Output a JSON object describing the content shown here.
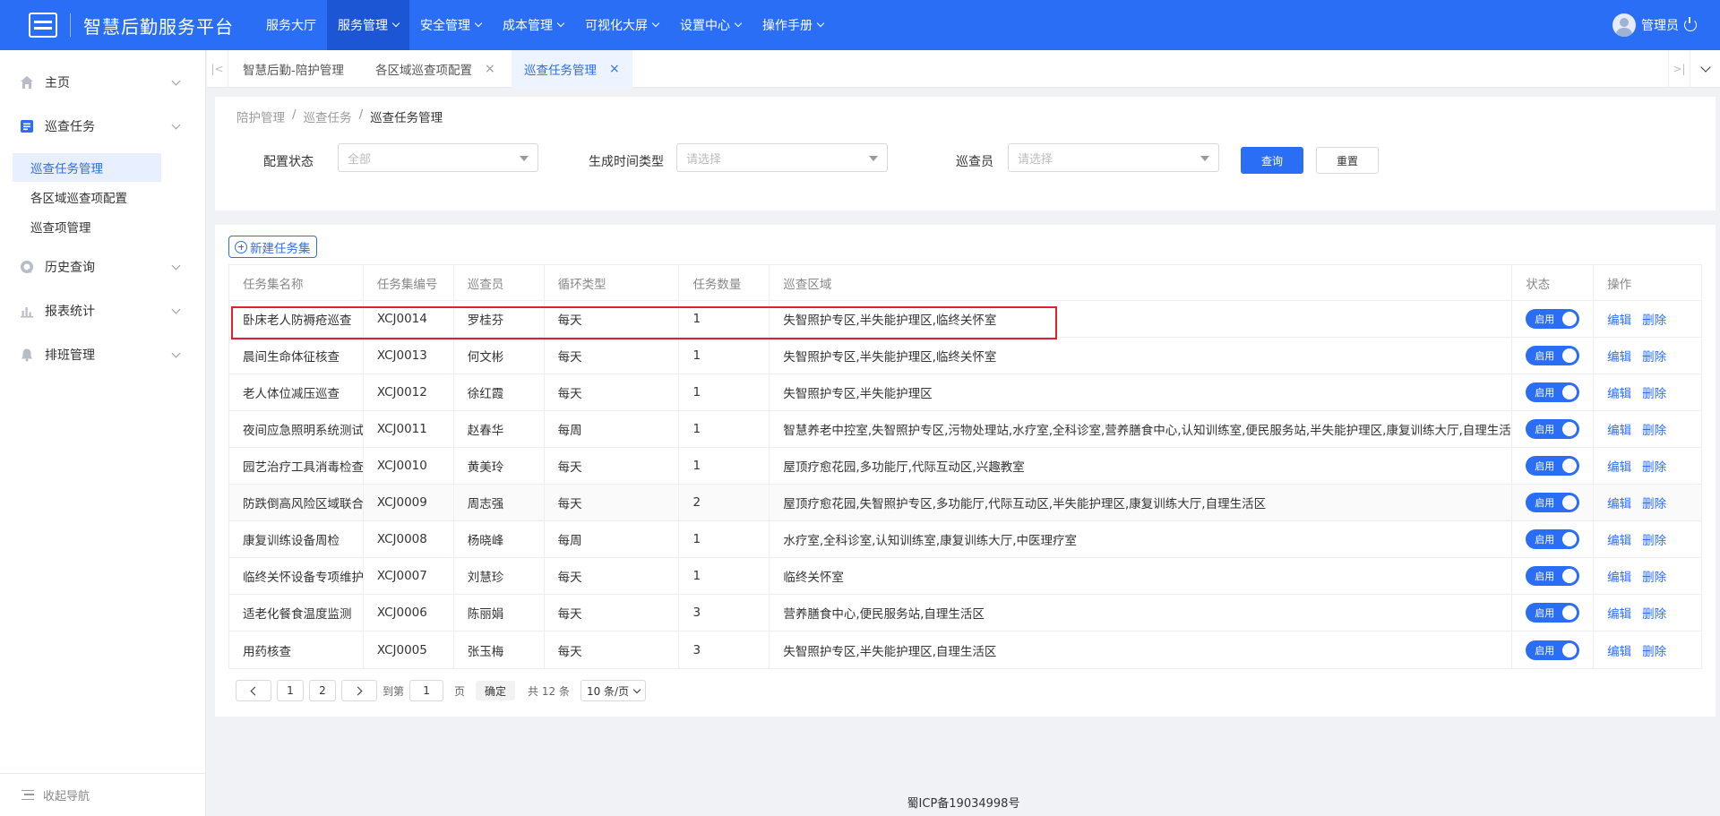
{
  "header": {
    "app_title": "智慧后勤服务平台",
    "nav": [
      {
        "label": "服务大厅",
        "dropdown": false,
        "active": false
      },
      {
        "label": "服务管理",
        "dropdown": true,
        "active": true
      },
      {
        "label": "安全管理",
        "dropdown": true,
        "active": false
      },
      {
        "label": "成本管理",
        "dropdown": true,
        "active": false
      },
      {
        "label": "可视化大屏",
        "dropdown": true,
        "active": false
      },
      {
        "label": "设置中心",
        "dropdown": true,
        "active": false
      },
      {
        "label": "操作手册",
        "dropdown": true,
        "active": false
      }
    ],
    "user_name": "管理员"
  },
  "sidebar": {
    "items": [
      {
        "label": "主页",
        "icon": "home-icon"
      },
      {
        "label": "巡查任务",
        "icon": "task-icon"
      },
      {
        "label": "历史查询",
        "icon": "history-icon"
      },
      {
        "label": "报表统计",
        "icon": "chart-icon"
      },
      {
        "label": "排班管理",
        "icon": "bell-icon"
      }
    ],
    "sub_items": [
      {
        "label": "巡查任务管理",
        "active": true
      },
      {
        "label": "各区域巡查项配置",
        "active": false
      },
      {
        "label": "巡查项管理",
        "active": false
      }
    ],
    "collapse_label": "收起导航"
  },
  "tabs": [
    {
      "label": "智慧后勤-陪护管理",
      "closable": false,
      "active": false
    },
    {
      "label": "各区域巡查项配置",
      "closable": true,
      "active": false
    },
    {
      "label": "巡查任务管理",
      "closable": true,
      "active": true
    }
  ],
  "breadcrumb": [
    "陪护管理",
    "巡查任务",
    "巡查任务管理"
  ],
  "filters": {
    "status_label": "配置状态",
    "status_value": "全部",
    "time_type_label": "生成时间类型",
    "time_type_placeholder": "请选择",
    "inspector_label": "巡查员",
    "inspector_placeholder": "请选择",
    "query_label": "查询",
    "reset_label": "重置"
  },
  "new_button_label": "新建任务集",
  "table": {
    "columns": [
      "任务集名称",
      "任务集编号",
      "巡查员",
      "循环类型",
      "任务数量",
      "巡查区域",
      "状态",
      "操作"
    ],
    "rows": [
      {
        "name": "卧床老人防褥疮巡查",
        "code": "XCJ0014",
        "inspector": "罗桂芬",
        "cycle": "每天",
        "count": "1",
        "area": "失智照护专区,半失能护理区,临终关怀室",
        "status": "启用"
      },
      {
        "name": "晨间生命体征核查",
        "code": "XCJ0013",
        "inspector": "何文彬",
        "cycle": "每天",
        "count": "1",
        "area": "失智照护专区,半失能护理区,临终关怀室",
        "status": "启用"
      },
      {
        "name": "老人体位减压巡查",
        "code": "XCJ0012",
        "inspector": "徐红霞",
        "cycle": "每天",
        "count": "1",
        "area": "失智照护专区,半失能护理区",
        "status": "启用"
      },
      {
        "name": "夜间应急照明系统测试",
        "code": "XCJ0011",
        "inspector": "赵春华",
        "cycle": "每周",
        "count": "1",
        "area": "智慧养老中控室,失智照护专区,污物处理站,水疗室,全科诊室,营养膳食中心,认知训练室,便民服务站,半失能护理区,康复训练大厅,自理生活区",
        "status": "启用"
      },
      {
        "name": "园艺治疗工具消毒检查",
        "code": "XCJ0010",
        "inspector": "黄美玲",
        "cycle": "每天",
        "count": "1",
        "area": "屋顶疗愈花园,多功能厅,代际互动区,兴趣教室",
        "status": "启用"
      },
      {
        "name": "防跌倒高风险区域联合巡查",
        "code": "XCJ0009",
        "inspector": "周志强",
        "cycle": "每天",
        "count": "2",
        "area": "屋顶疗愈花园,失智照护专区,多功能厅,代际互动区,半失能护理区,康复训练大厅,自理生活区",
        "status": "启用"
      },
      {
        "name": "康复训练设备周检",
        "code": "XCJ0008",
        "inspector": "杨晓峰",
        "cycle": "每周",
        "count": "1",
        "area": "水疗室,全科诊室,认知训练室,康复训练大厅,中医理疗室",
        "status": "启用"
      },
      {
        "name": "临终关怀设备专项维护",
        "code": "XCJ0007",
        "inspector": "刘慧珍",
        "cycle": "每天",
        "count": "1",
        "area": "临终关怀室",
        "status": "启用"
      },
      {
        "name": "适老化餐食温度监测",
        "code": "XCJ0006",
        "inspector": "陈丽娟",
        "cycle": "每天",
        "count": "3",
        "area": "营养膳食中心,便民服务站,自理生活区",
        "status": "启用"
      },
      {
        "name": "用药核查",
        "code": "XCJ0005",
        "inspector": "张玉梅",
        "cycle": "每天",
        "count": "3",
        "area": "失智照护专区,半失能护理区,自理生活区",
        "status": "启用"
      }
    ],
    "edit_label": "编辑",
    "delete_label": "删除"
  },
  "pagination": {
    "pages": [
      "1",
      "2"
    ],
    "goto_label": "到第",
    "goto_value": "1",
    "page_unit": "页",
    "confirm_label": "确定",
    "total_label": "共 12 条",
    "page_size": "10 条/页"
  },
  "footer": {
    "icp": "蜀ICP备19034998号"
  },
  "colors": {
    "primary": "#2b6ef6",
    "highlight": "#e0202a"
  }
}
